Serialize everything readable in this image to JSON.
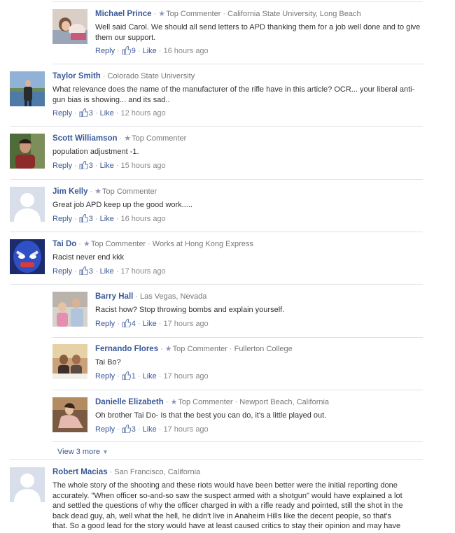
{
  "comments": [
    {
      "author": "Michael Prince",
      "badge": "Top Commenter",
      "affiliation": "California State University, Long Beach",
      "text": "Well said Carol. We should all send letters to APD thanking them for a job well done and to give them our support.",
      "reply": "Reply",
      "likes": "9",
      "like": "Like",
      "time": "16 hours ago",
      "avatar": "couple-photo"
    },
    {
      "author": "Taylor Smith",
      "badge": "",
      "affiliation": "Colorado State University",
      "text": "What relevance does the name of the manufacturer of the rifle have in this article? OCR... your liberal anti-gun bias is showing... and its sad..",
      "reply": "Reply",
      "likes": "3",
      "like": "Like",
      "time": "12 hours ago",
      "avatar": "lake-photo"
    },
    {
      "author": "Scott Williamson",
      "badge": "Top Commenter",
      "affiliation": "",
      "text": "population adjustment -1.",
      "reply": "Reply",
      "likes": "3",
      "like": "Like",
      "time": "15 hours ago",
      "avatar": "man-photo"
    },
    {
      "author": "Jim Kelly",
      "badge": "Top Commenter",
      "affiliation": "",
      "text": "Great job APD keep up the good work.....",
      "reply": "Reply",
      "likes": "3",
      "like": "Like",
      "time": "16 hours ago",
      "avatar": "default-silhouette"
    },
    {
      "author": "Tai Do",
      "badge": "Top Commenter",
      "affiliation": "Works at Hong Kong Express",
      "text": "Racist never end kkk",
      "reply": "Reply",
      "likes": "3",
      "like": "Like",
      "time": "17 hours ago",
      "avatar": "mask-photo"
    },
    {
      "author": "Barry Hall",
      "badge": "",
      "affiliation": "Las Vegas, Nevada",
      "text": "Racist how? Stop throwing bombs and explain yourself.",
      "reply": "Reply",
      "likes": "4",
      "like": "Like",
      "time": "17 hours ago",
      "avatar": "family-photo"
    },
    {
      "author": "Fernando Flores",
      "badge": "Top Commenter",
      "affiliation": "Fullerton College",
      "text": "Tai Bo?",
      "reply": "Reply",
      "likes": "1",
      "like": "Like",
      "time": "17 hours ago",
      "avatar": "group-photo"
    },
    {
      "author": "Danielle Elizabeth",
      "badge": "Top Commenter",
      "affiliation": "Newport Beach, California",
      "text": "Oh brother Tai Do- Is that the best you can do, it's a little played out.",
      "reply": "Reply",
      "likes": "3",
      "like": "Like",
      "time": "17 hours ago",
      "avatar": "woman-photo"
    },
    {
      "author": "Robert Macias",
      "badge": "",
      "affiliation": "San Francisco, California",
      "text": "The whole story of the shooting and these riots would have been better were the initial reporting done accurately. \"When officer so-and-so saw the suspect armed with a shotgun\" would have explained a lot and settled the questions of why the officer charged in with a rifle ready and pointed, still the shot in the back dead guy, ah, well what the hell, he didn't live in Anaheim Hills like the decent people, so that's that. So a good lead for the story would have at least caused critics to stay their opinion and may have",
      "avatar": "default-silhouette"
    }
  ],
  "view_more": "View 3 more",
  "colors": {
    "link": "#3b5998",
    "meta": "#777777",
    "divider": "#e1e3e8"
  }
}
